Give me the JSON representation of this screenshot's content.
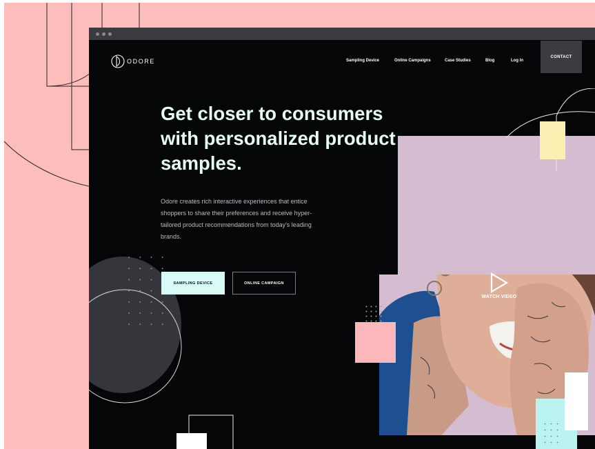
{
  "brand": {
    "name": "ODORE"
  },
  "nav": {
    "items": [
      {
        "label": "Sampling Device"
      },
      {
        "label": "Online Campaigns"
      },
      {
        "label": "Case Studies"
      },
      {
        "label": "Blog"
      },
      {
        "label": "Log In"
      }
    ],
    "contact_label": "CONTACT"
  },
  "hero": {
    "headline": "Get closer to consumers with personalized product samples.",
    "body": "Odore creates rich interactive experiences that entice shoppers to share their preferences and receive hyper-tailored product recommendations from today's leading brands.",
    "primary_button": "SAMPLING DEVICE",
    "secondary_button": "ONLINE CAMPAIGN",
    "video_label": "WATCH VIDEO"
  },
  "colors": {
    "page_background": "#fcbdbb",
    "site_background": "#050607",
    "headline": "#e4fbf6",
    "primary_button": "#d9fbf8",
    "contact_button": "#3b3c42",
    "accent_pink": "#fbb7b9",
    "accent_cream": "#fbf0b1",
    "accent_mint": "#bbf3f0",
    "photo_backdrop": "#d6bcd1"
  },
  "icons": [
    "logo-mark-icon",
    "play-icon"
  ]
}
